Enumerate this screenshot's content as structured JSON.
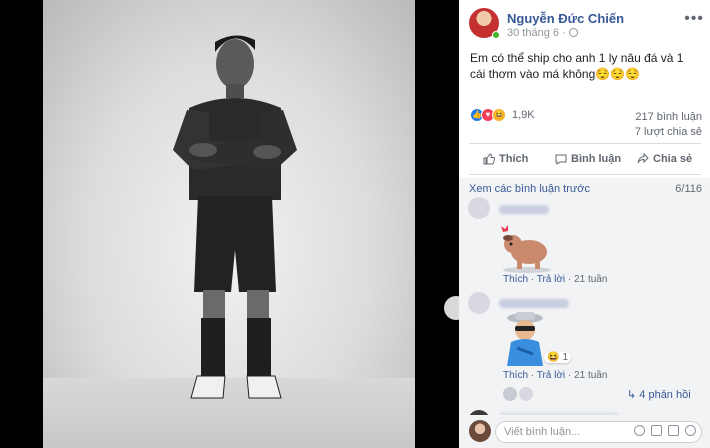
{
  "post": {
    "author": "Nguyễn Đức Chiến",
    "timestamp": "30 tháng 6 ·",
    "text": "Em có thể ship cho anh 1 ly nâu đá và 1 cái thơm vào má không😌😌😌",
    "reaction_count": "1,9K",
    "comment_stat": "217 bình luận",
    "share_stat": "7 lượt chia sẻ"
  },
  "actions": {
    "like": "Thích",
    "comment": "Bình luận",
    "share": "Chia sẻ"
  },
  "comments": {
    "view_previous": "Xem các bình luận trước",
    "counter": "6/116",
    "items": [
      {
        "like": "Thích",
        "reply": "Trả lời",
        "time": "21 tuần",
        "sticker": "dog-sticker"
      },
      {
        "like": "Thích",
        "reply": "Trả lời",
        "time": "21 tuần",
        "sticker": "old-man-sticker",
        "reaction_count": "1",
        "replies": "4 phản hồi"
      }
    ],
    "input_placeholder": "Viết bình luận..."
  },
  "colors": {
    "link": "#385898",
    "like_blue": "#2078f4",
    "love_red": "#f33e58",
    "haha_yellow": "#f7b125",
    "online": "#42b72a"
  }
}
